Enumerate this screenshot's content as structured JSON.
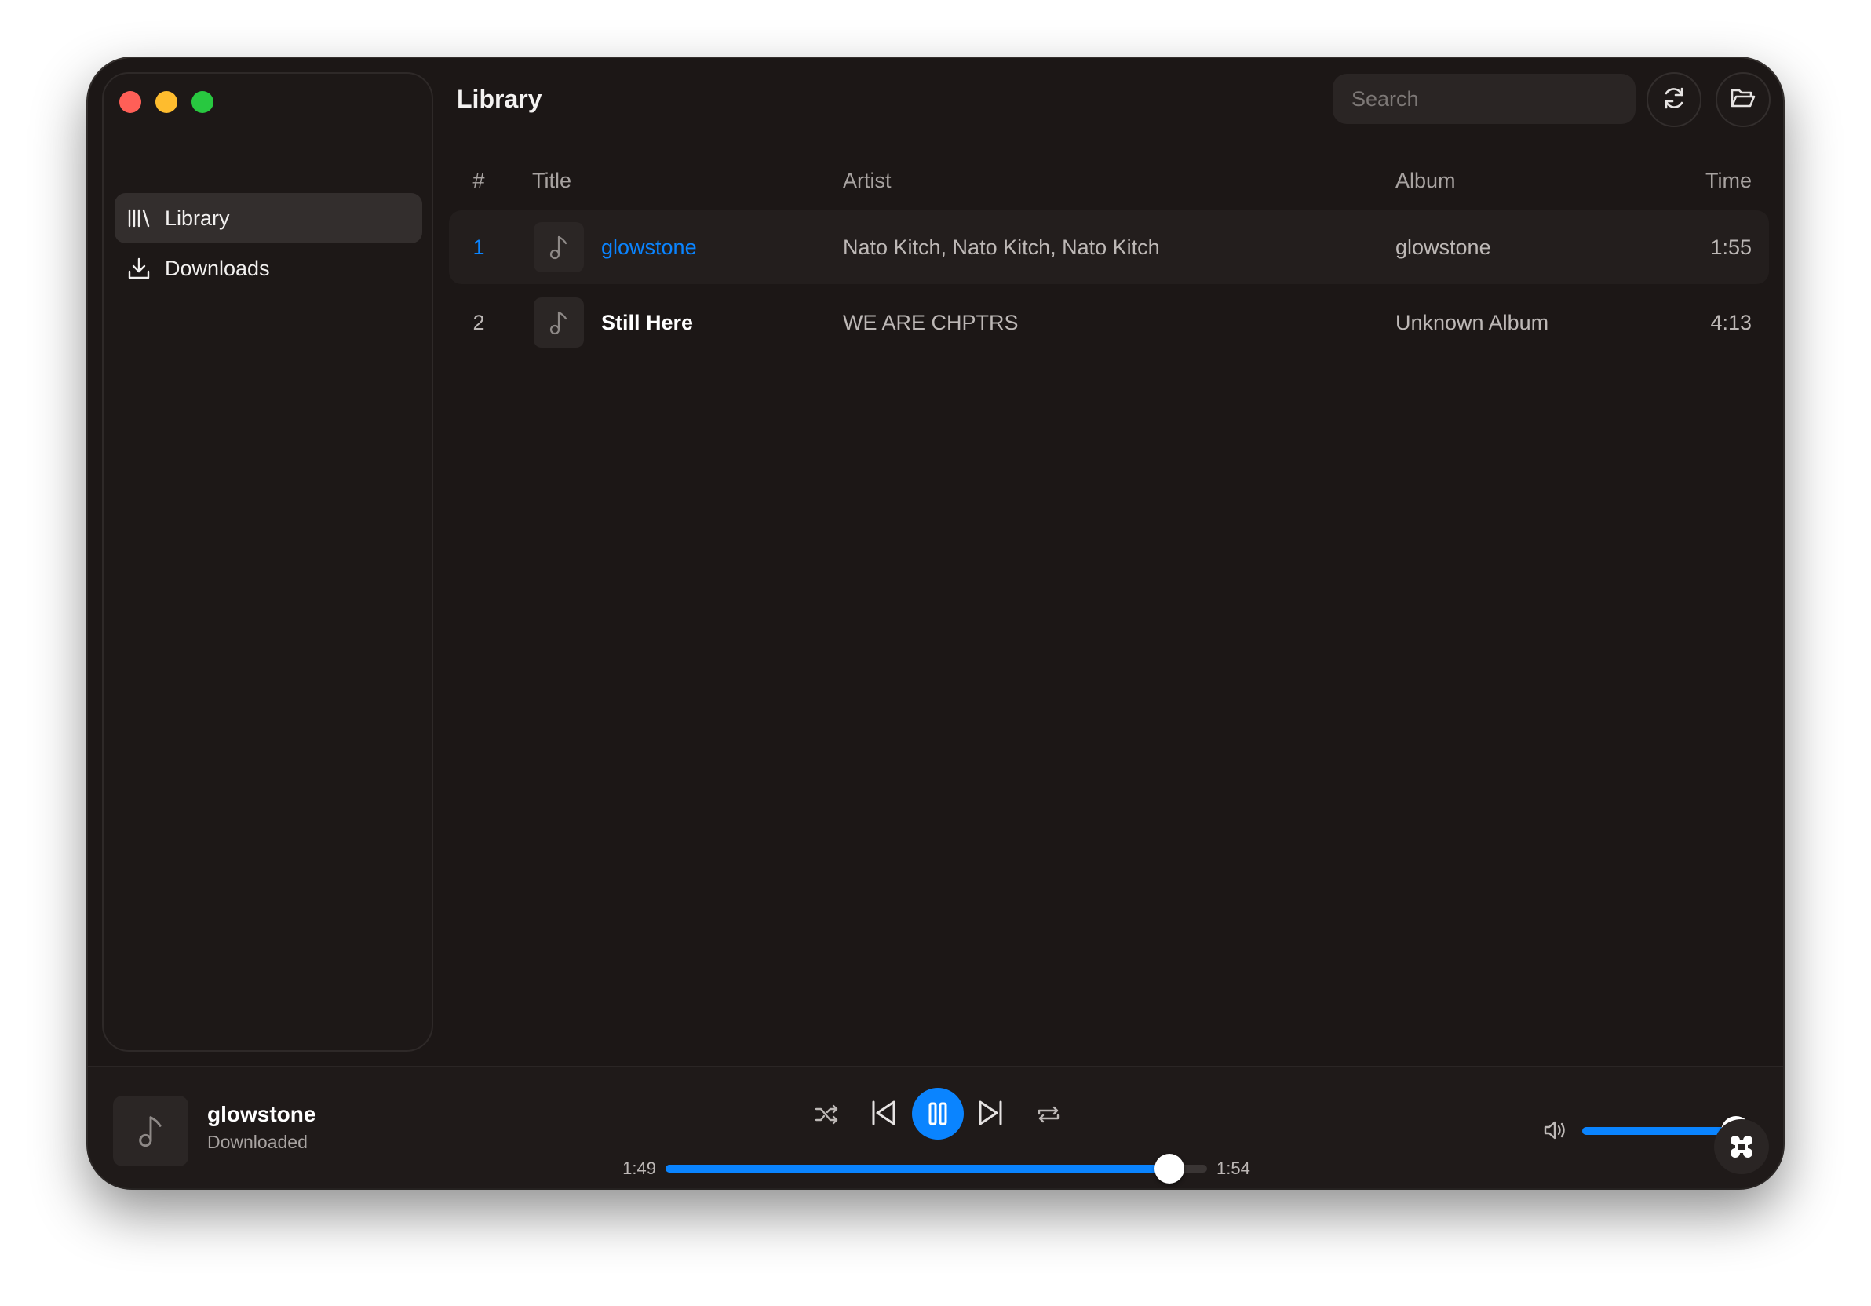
{
  "window": {
    "controls": [
      "close",
      "minimize",
      "zoom"
    ]
  },
  "sidebar": {
    "items": [
      {
        "label": "Library",
        "icon": "library-icon",
        "active": true
      },
      {
        "label": "Downloads",
        "icon": "download-icon",
        "active": false
      }
    ]
  },
  "header": {
    "title": "Library",
    "search_placeholder": "Search",
    "refresh_icon": "refresh-icon",
    "folder_icon": "folder-open-icon"
  },
  "table": {
    "columns": {
      "num": "#",
      "title": "Title",
      "artist": "Artist",
      "album": "Album",
      "time": "Time"
    },
    "rows": [
      {
        "num": "1",
        "title": "glowstone",
        "artist": "Nato Kitch, Nato Kitch, Nato Kitch",
        "album": "glowstone",
        "time": "1:55",
        "playing": true
      },
      {
        "num": "2",
        "title": "Still Here",
        "artist": "WE ARE CHPTRS",
        "album": "Unknown Album",
        "time": "4:13",
        "playing": false
      }
    ]
  },
  "player": {
    "title": "glowstone",
    "status": "Downloaded",
    "elapsed": "1:49",
    "total": "1:54",
    "progress_fraction": 0.93,
    "volume_fraction": 1.0,
    "state": "playing"
  },
  "colors": {
    "accent": "#0a84ff",
    "background": "#1c1716",
    "sidebar_active": "#332e2d"
  }
}
